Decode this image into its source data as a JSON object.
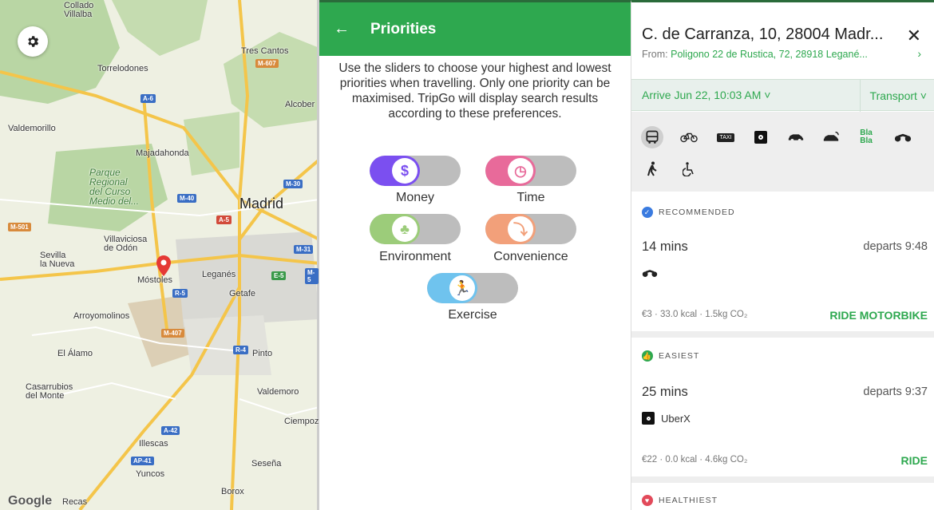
{
  "map": {
    "labels": {
      "collado_villalba": "Collado\nVillalba",
      "torrelodones": "Torrelodones",
      "tres_cantos": "Tres Cantos",
      "alcobendas": "Alcober",
      "valdemorillo": "Valdemorillo",
      "majadahonda": "Majadahonda",
      "parque": "Parque\nRegional\ndel Curso\nMedio del...",
      "madrid": "Madrid",
      "villaviciosa": "Villaviciosa\nde Odón",
      "sevilla": "Sevilla\nla Nueva",
      "mostoles": "Móstoles",
      "leganes": "Leganés",
      "getafe": "Getafe",
      "arroyomolinos": "Arroyomolinos",
      "el_alamo": "El Álamo",
      "pinto": "Pinto",
      "casarrubios": "Casarrubios\ndel Monte",
      "valdemoro": "Valdemoro",
      "ciempozuelos": "Ciempoz",
      "illescas": "Illescas",
      "sesena": "Seseña",
      "yuncos": "Yuncos",
      "borox": "Borox",
      "recas": "Recas",
      "google": "Google"
    },
    "shields": {
      "m607": "M-607",
      "a6": "A-6",
      "m30": "M-30",
      "m40": "M-40",
      "a5": "A-5",
      "m501": "M-501",
      "m31": "M-31",
      "e5": "E-5",
      "m5": "M-5",
      "r5": "R-5",
      "m407": "M-407",
      "r4": "R-4",
      "a42": "A-42",
      "ap41": "AP-41"
    }
  },
  "priorities": {
    "back_label": "←",
    "title": "Priorities",
    "description": "Use the sliders to choose your highest and lowest priorities when travelling. Only one priority can be maximised. TripGo will display search results according to these preferences.",
    "sliders": [
      {
        "label": "Money",
        "icon": "$",
        "color": "#7b4ff0",
        "level": 0.55
      },
      {
        "label": "Time",
        "icon": "◷",
        "color": "#e86a9a",
        "level": 0.55
      },
      {
        "label": "Environment",
        "icon": "♣",
        "color": "#9ccc7a",
        "level": 0.55
      },
      {
        "label": "Convenience",
        "icon": "⤵",
        "color": "#f2a07a",
        "level": 0.55
      },
      {
        "label": "Exercise",
        "icon": "🏃",
        "color": "#6fc3ee",
        "level": 0.55
      }
    ]
  },
  "results": {
    "destination": "C. de Carranza, 10, 28004 Madr...",
    "close": "✕",
    "from_prefix": "From: ",
    "from_address": "Poligono 22 de Rustica, 72, 28918 Legané...",
    "from_chevron": "›",
    "arrive": "Arrive Jun 22, 10:03 AM ˅",
    "transport": "Transport ˅",
    "bla_label": "Bla\nBla",
    "taxi_label": "TAXI",
    "trips": [
      {
        "badge": "RECOMMENDED",
        "badge_color": "#3a7be0",
        "badge_icon": "✓",
        "duration": "14 mins",
        "departs": "departs 9:48",
        "mode_label": "",
        "meta": "€3 · 33.0 kcal · 1.5kg CO₂",
        "action": "RIDE MOTORBIKE"
      },
      {
        "badge": "EASIEST",
        "badge_color": "#2ea84f",
        "badge_icon": "👍",
        "duration": "25 mins",
        "departs": "departs 9:37",
        "mode_label": "UberX",
        "meta": "€22 · 0.0 kcal · 4.6kg CO₂",
        "action": "RIDE"
      },
      {
        "badge": "HEALTHIEST",
        "badge_color": "#e24a5a",
        "badge_icon": "♥"
      }
    ]
  }
}
